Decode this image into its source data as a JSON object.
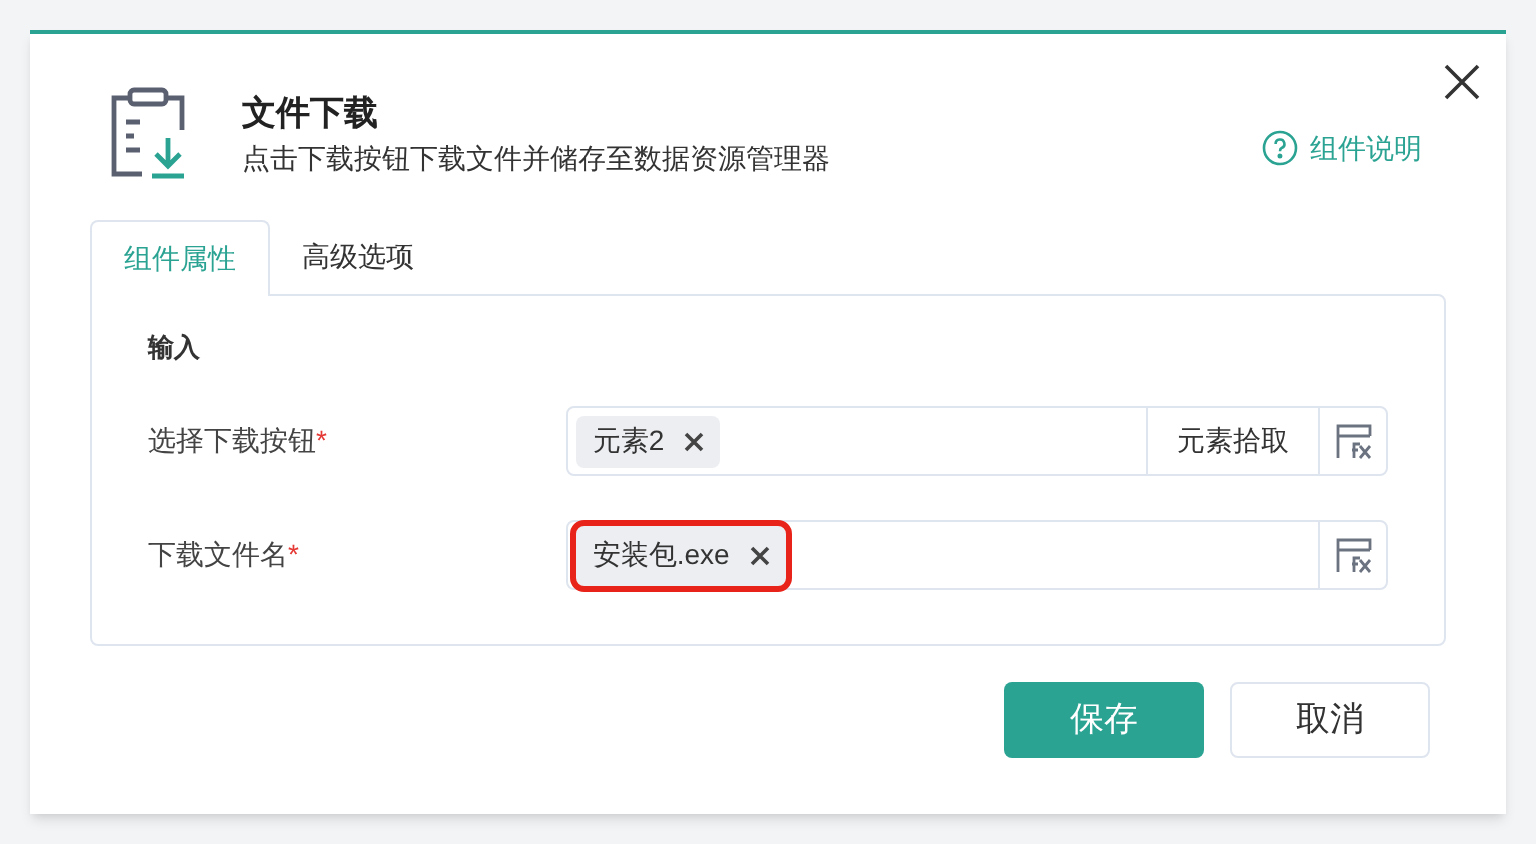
{
  "dialog": {
    "title": "文件下载",
    "subtitle": "点击下载按钮下载文件并储存至数据资源管理器",
    "help_link": "组件说明"
  },
  "tabs": [
    {
      "label": "组件属性",
      "selected": true
    },
    {
      "label": "高级选项",
      "selected": false
    }
  ],
  "section_title": "输入",
  "fields": [
    {
      "label": "选择下载按钮",
      "required_mark": "*",
      "tags": [
        {
          "text": "元素2",
          "highlighted": false
        }
      ],
      "pick_button": "元素拾取"
    },
    {
      "label": "下载文件名",
      "required_mark": "*",
      "tags": [
        {
          "text": "安装包.exe",
          "highlighted": true
        }
      ]
    }
  ],
  "buttons": {
    "save": "保存",
    "cancel": "取消"
  }
}
